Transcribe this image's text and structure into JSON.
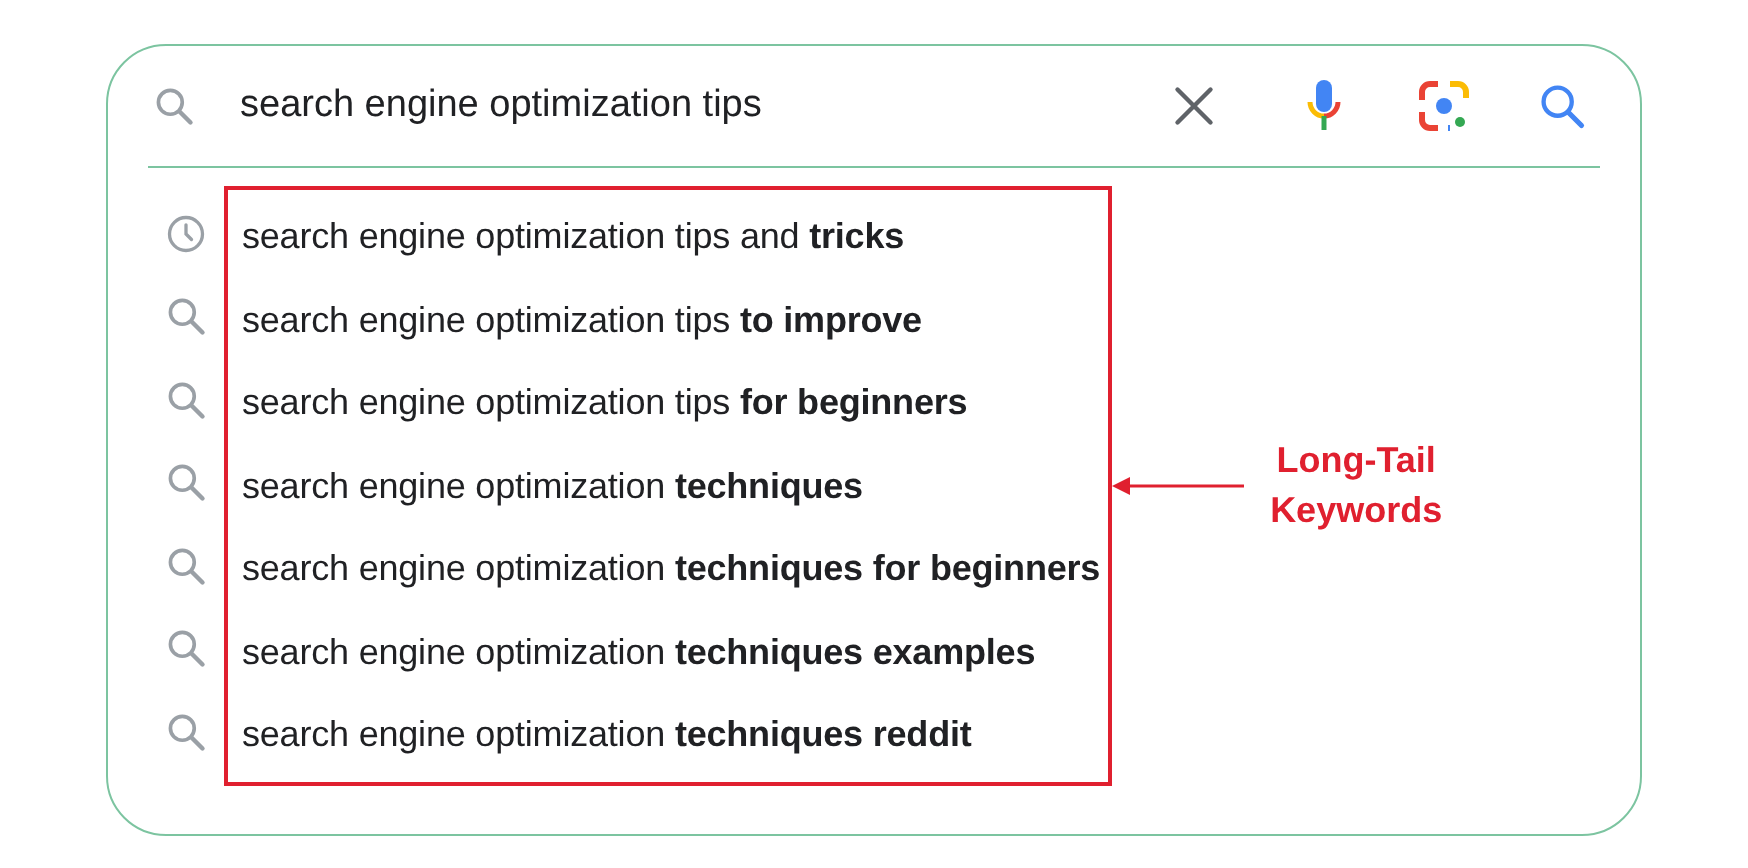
{
  "search": {
    "value": "search engine optimization tips"
  },
  "suggestions": [
    {
      "kind": "history",
      "text": "search engine optimization tips and **tricks**"
    },
    {
      "kind": "search",
      "text": "search engine optimization tips **to improve**"
    },
    {
      "kind": "search",
      "text": "search engine optimization tips **for beginners**"
    },
    {
      "kind": "search",
      "text": "search engine optimization **techniques**"
    },
    {
      "kind": "search",
      "text": "search engine optimization **techniques for beginners**"
    },
    {
      "kind": "search",
      "text": "search engine optimization **techniques examples**"
    },
    {
      "kind": "search",
      "text": "search engine optimization **techniques reddit**"
    }
  ],
  "annotation": {
    "label": "Long-Tail Keywords"
  }
}
